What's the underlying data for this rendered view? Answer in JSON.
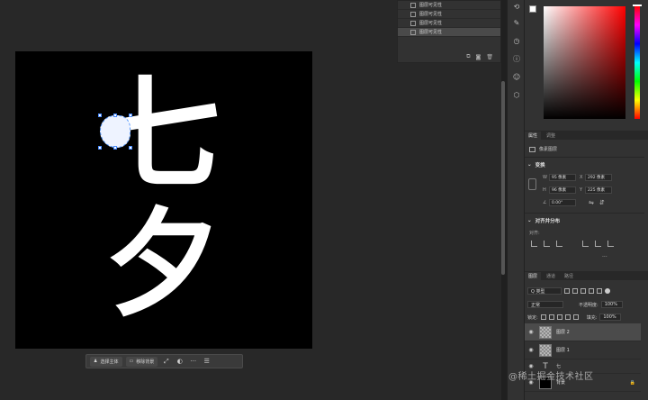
{
  "canvas": {
    "glyph_top": "七",
    "glyph_bottom": "夕"
  },
  "task_bar": {
    "select_subject_label": "选择主体",
    "remove_bg_label": "移除背景",
    "more_label": "···"
  },
  "history": {
    "items": [
      "图层可见性",
      "图层可见性",
      "图层可见性",
      "图层可见性"
    ]
  },
  "properties": {
    "tabs": [
      "属性",
      "调整"
    ],
    "layer_kind": "像素图层",
    "transform_title": "变换",
    "w_label": "W",
    "w_value": "95 像素",
    "h_label": "H",
    "h_value": "96 像素",
    "x_label": "X",
    "x_value": "292 像素",
    "y_label": "Y",
    "y_value": "225 像素",
    "angle_value": "0.00°",
    "align_title": "对齐并分布",
    "align_sub": "对齐:",
    "more_label": "···"
  },
  "layers": {
    "tabs": [
      "图层",
      "通道",
      "路径"
    ],
    "filter_label": "Q 类型",
    "blend_mode": "正常",
    "opacity_label": "不透明度:",
    "opacity_value": "100%",
    "lock_label": "锁定:",
    "fill_label": "填充:",
    "fill_value": "100%",
    "rows": [
      {
        "name": "图层 2"
      },
      {
        "name": "图层 1"
      },
      {
        "name": "七"
      },
      {
        "name": "背景"
      }
    ]
  },
  "watermark": "@稀土掘金技术社区",
  "colors": {
    "app_bg": "#282828",
    "panel_bg": "#323232",
    "selection_blue": "#4a8cff"
  }
}
